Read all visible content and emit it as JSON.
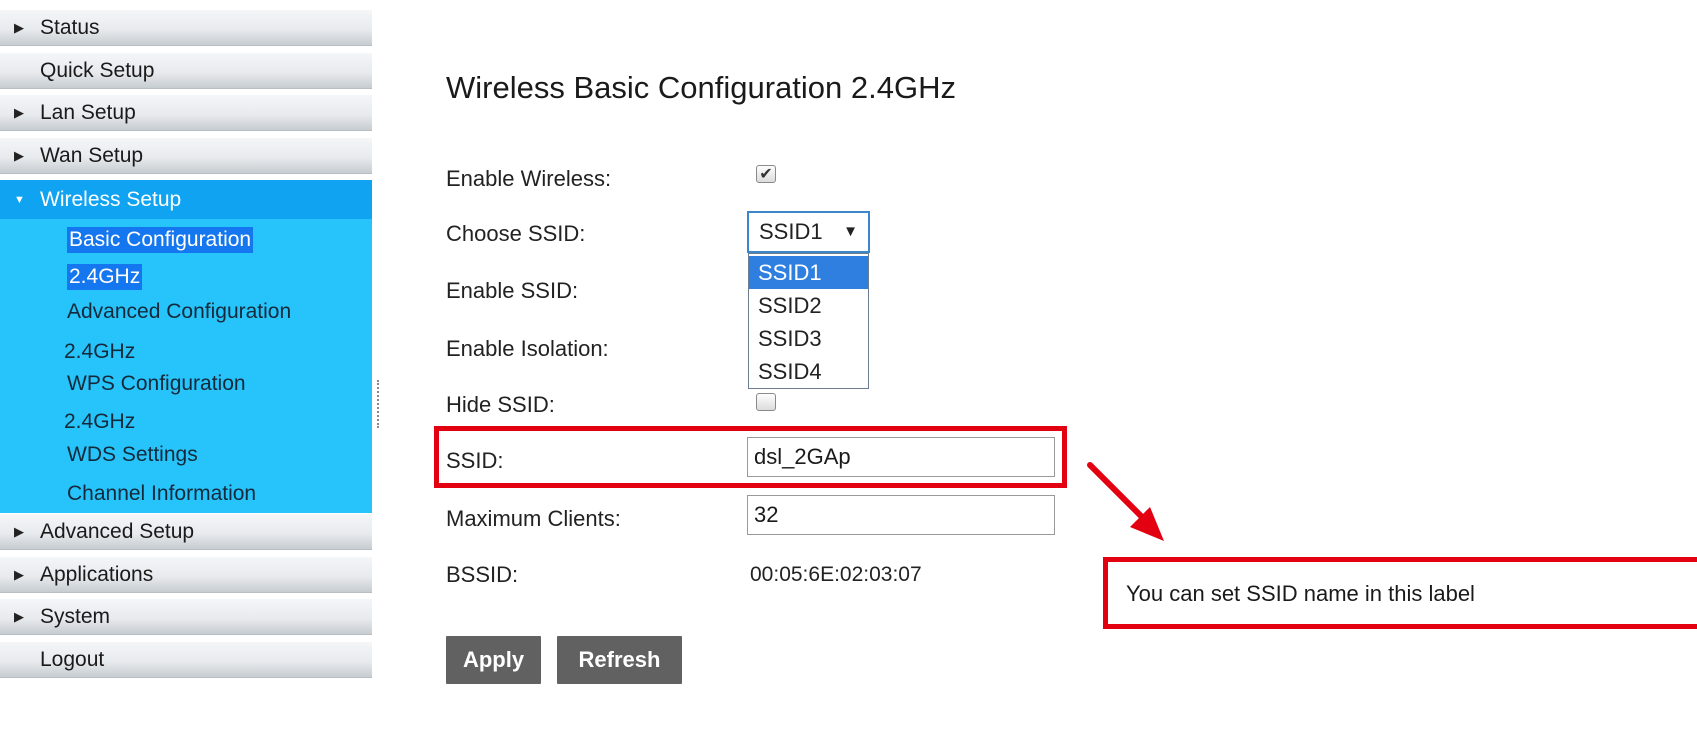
{
  "sidebar": {
    "items": [
      {
        "label": "Status",
        "marker": "▶"
      },
      {
        "label": "Quick Setup",
        "marker": ""
      },
      {
        "label": "Lan Setup",
        "marker": "▶"
      },
      {
        "label": "Wan Setup",
        "marker": "▶"
      },
      {
        "label": "Wireless Setup",
        "marker": "▼"
      },
      {
        "label": "Advanced Setup",
        "marker": "▶"
      },
      {
        "label": "Applications",
        "marker": "▶"
      },
      {
        "label": "System",
        "marker": "▶"
      },
      {
        "label": "Logout",
        "marker": ""
      }
    ],
    "wireless_sub": {
      "basic_configuration": "Basic Configuration",
      "basic_band": "2.4GHz",
      "advanced_configuration": "Advanced Configuration",
      "advanced_band": "2.4GHz",
      "wps_configuration": "WPS Configuration",
      "wps_band": "2.4GHz",
      "wds_settings": "WDS Settings",
      "channel_information": "Channel Information"
    }
  },
  "main": {
    "title": "Wireless Basic Configuration 2.4GHz",
    "labels": {
      "enable_wireless": "Enable Wireless:",
      "choose_ssid": "Choose SSID:",
      "enable_ssid": "Enable SSID:",
      "enable_isolation": "Enable Isolation:",
      "hide_ssid": "Hide SSID:",
      "ssid": "SSID:",
      "maximum_clients": "Maximum Clients:",
      "bssid": "BSSID:"
    },
    "enable_wireless_checked": true,
    "hide_ssid_checked": false,
    "choose_ssid": {
      "selected": "SSID1",
      "arrow": "▼",
      "options": [
        "SSID1",
        "SSID2",
        "SSID3",
        "SSID4"
      ]
    },
    "ssid_value": "dsl_2GAp",
    "max_clients_value": "32",
    "bssid_value": "00:05:6E:02:03:07",
    "buttons": {
      "apply": "Apply",
      "refresh": "Refresh"
    }
  },
  "annotation": {
    "callout_text": "You can set SSID name in this label",
    "color": "#e30010"
  }
}
